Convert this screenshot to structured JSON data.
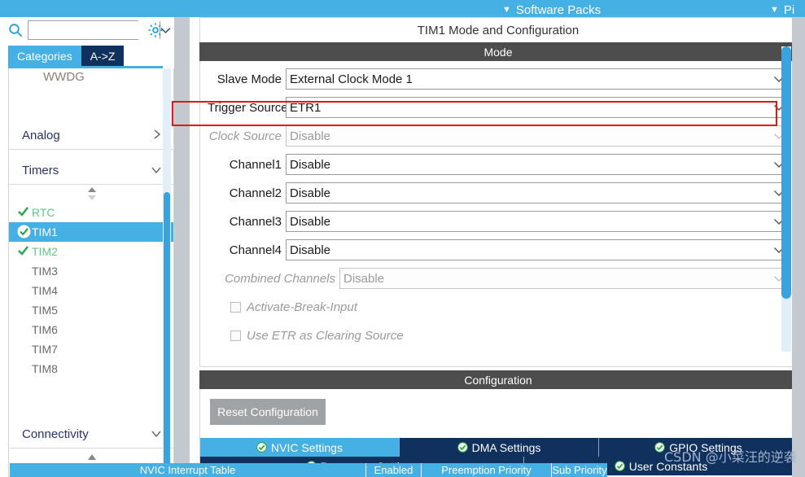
{
  "topbar": {
    "menu_items": [
      {
        "label": "Software Packs",
        "icon": "chevron-down-icon"
      },
      {
        "label": "Pi",
        "icon": "chevron-down-icon"
      }
    ],
    "background": "#45b0e3"
  },
  "sidebar": {
    "search": {
      "value": "",
      "placeholder": "",
      "icon": "search-icon"
    },
    "settings_icon": "gear-icon",
    "tabs": [
      {
        "label": "Categories",
        "active": true
      },
      {
        "label": "A->Z",
        "active": false
      }
    ],
    "partial_item_above": "WWDG",
    "categories": [
      {
        "label": "Analog",
        "expanded": false,
        "chevron": "chevron-right-icon"
      },
      {
        "label": "Timers",
        "expanded": true,
        "chevron": "chevron-down-icon"
      },
      {
        "label": "Connectivity",
        "expanded": false,
        "chevron": "chevron-down-icon"
      }
    ],
    "timers": [
      {
        "label": "RTC",
        "state": "configured",
        "selected": false
      },
      {
        "label": "TIM1",
        "state": "configured",
        "selected": true
      },
      {
        "label": "TIM2",
        "state": "configured",
        "selected": false
      },
      {
        "label": "TIM3",
        "state": "none",
        "selected": false
      },
      {
        "label": "TIM4",
        "state": "none",
        "selected": false
      },
      {
        "label": "TIM5",
        "state": "none",
        "selected": false
      },
      {
        "label": "TIM6",
        "state": "none",
        "selected": false
      },
      {
        "label": "TIM7",
        "state": "none",
        "selected": false
      },
      {
        "label": "TIM8",
        "state": "none",
        "selected": false
      }
    ],
    "scroll_thumb_color": "#3aa3dd"
  },
  "main": {
    "panel_title": "TIM1 Mode and Configuration",
    "mode_header": "Mode",
    "configuration_header": "Configuration",
    "mode_fields": [
      {
        "label": "Slave Mode",
        "value": "External Clock Mode 1",
        "disabled": false,
        "highlighted": false
      },
      {
        "label": "Trigger Source",
        "value": "ETR1",
        "disabled": false,
        "highlighted": true
      },
      {
        "label": "Clock Source",
        "value": "Disable",
        "disabled": true,
        "highlighted": false
      },
      {
        "label": "Channel1",
        "value": "Disable",
        "disabled": false,
        "highlighted": false
      },
      {
        "label": "Channel2",
        "value": "Disable",
        "disabled": false,
        "highlighted": false
      },
      {
        "label": "Channel3",
        "value": "Disable",
        "disabled": false,
        "highlighted": false
      },
      {
        "label": "Channel4",
        "value": "Disable",
        "disabled": false,
        "highlighted": false
      },
      {
        "label": "Combined Channels",
        "value": "Disable",
        "disabled": true,
        "highlighted": false
      }
    ],
    "mode_checkboxes": [
      {
        "label": "Activate-Break-Input",
        "checked": false,
        "disabled": true
      },
      {
        "label": "Use ETR as Clearing Source",
        "checked": false,
        "disabled": true
      }
    ],
    "highlight_color": "#ee1111",
    "reset_button": "Reset Configuration",
    "config_tabs_row1": [
      {
        "label": "NVIC Settings",
        "active": true,
        "icon": "check-circle-icon"
      },
      {
        "label": "DMA Settings",
        "active": false,
        "icon": "check-circle-icon"
      },
      {
        "label": "GPIO Settings",
        "active": false,
        "icon": "check-circle-icon"
      }
    ],
    "config_tabs_row2": [
      {
        "label": "Parameter Settings",
        "active": false,
        "icon": "check-circle-icon"
      },
      {
        "label": "User Constants",
        "active": false,
        "icon": "check-circle-icon"
      }
    ],
    "nvic_table_headers": [
      "NVIC Interrupt Table",
      "Enabled",
      "Preemption Priority",
      "Sub Priority"
    ]
  },
  "watermark": "CSDN @小菜汪的逆袭"
}
